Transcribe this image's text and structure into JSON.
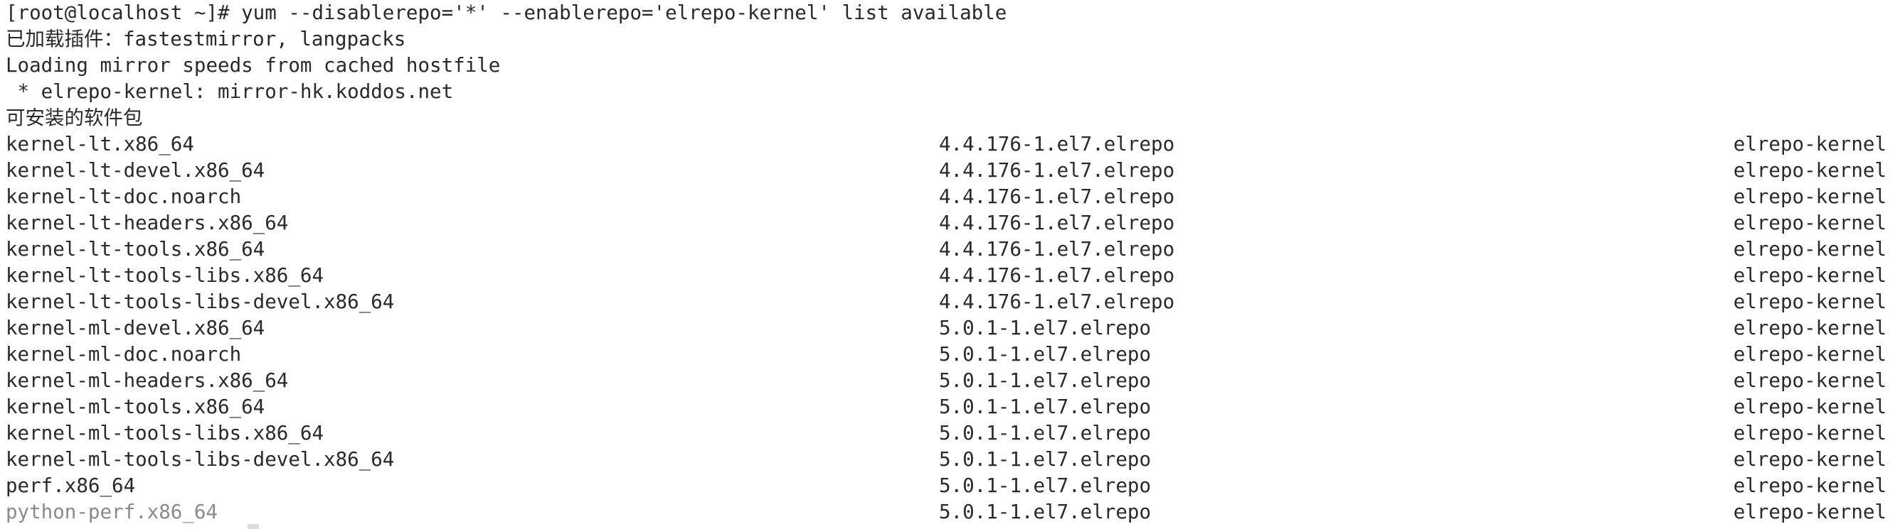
{
  "terminal": {
    "prompt": "[root@localhost ~]# yum --disablerepo='*' --enablerepo='elrepo-kernel' list available",
    "plugins_line": "已加载插件：fastestmirror, langpacks",
    "mirror_line": "Loading mirror speeds from cached hostfile",
    "mirror_entry": " * elrepo-kernel: mirror-hk.koddos.net",
    "available_header": "可安装的软件包",
    "packages": [
      {
        "name": "kernel-lt.x86_64",
        "version": "4.4.176-1.el7.elrepo",
        "repo": "elrepo-kernel"
      },
      {
        "name": "kernel-lt-devel.x86_64",
        "version": "4.4.176-1.el7.elrepo",
        "repo": "elrepo-kernel"
      },
      {
        "name": "kernel-lt-doc.noarch",
        "version": "4.4.176-1.el7.elrepo",
        "repo": "elrepo-kernel"
      },
      {
        "name": "kernel-lt-headers.x86_64",
        "version": "4.4.176-1.el7.elrepo",
        "repo": "elrepo-kernel"
      },
      {
        "name": "kernel-lt-tools.x86_64",
        "version": "4.4.176-1.el7.elrepo",
        "repo": "elrepo-kernel"
      },
      {
        "name": "kernel-lt-tools-libs.x86_64",
        "version": "4.4.176-1.el7.elrepo",
        "repo": "elrepo-kernel"
      },
      {
        "name": "kernel-lt-tools-libs-devel.x86_64",
        "version": "4.4.176-1.el7.elrepo",
        "repo": "elrepo-kernel"
      },
      {
        "name": "kernel-ml-devel.x86_64",
        "version": "5.0.1-1.el7.elrepo",
        "repo": "elrepo-kernel"
      },
      {
        "name": "kernel-ml-doc.noarch",
        "version": "5.0.1-1.el7.elrepo",
        "repo": "elrepo-kernel"
      },
      {
        "name": "kernel-ml-headers.x86_64",
        "version": "5.0.1-1.el7.elrepo",
        "repo": "elrepo-kernel"
      },
      {
        "name": "kernel-ml-tools.x86_64",
        "version": "5.0.1-1.el7.elrepo",
        "repo": "elrepo-kernel"
      },
      {
        "name": "kernel-ml-tools-libs.x86_64",
        "version": "5.0.1-1.el7.elrepo",
        "repo": "elrepo-kernel"
      },
      {
        "name": "kernel-ml-tools-libs-devel.x86_64",
        "version": "5.0.1-1.el7.elrepo",
        "repo": "elrepo-kernel"
      },
      {
        "name": "perf.x86_64",
        "version": "5.0.1-1.el7.elrepo",
        "repo": "elrepo-kernel"
      },
      {
        "name": "python-perf.x86_64",
        "version": "5.0.1-1.el7.elrepo",
        "repo": "elrepo-kernel"
      }
    ]
  }
}
